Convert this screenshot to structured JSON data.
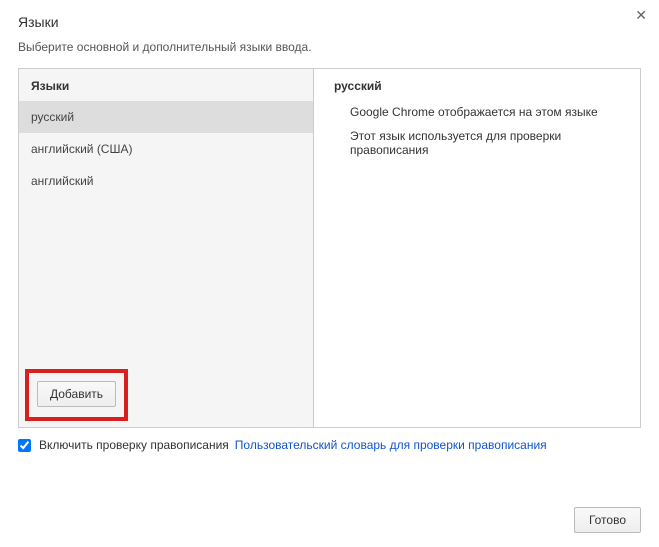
{
  "dialog": {
    "title": "Языки",
    "subtitle": "Выберите основной и дополнительный языки ввода."
  },
  "leftPane": {
    "header": "Языки",
    "languages": [
      {
        "name": "русский",
        "selected": true
      },
      {
        "name": "английский (США)",
        "selected": false
      },
      {
        "name": "английский",
        "selected": false
      }
    ],
    "addButton": "Добавить"
  },
  "rightPane": {
    "header": "русский",
    "line1": "Google Chrome отображается на этом языке",
    "line2": "Этот язык используется для проверки правописания"
  },
  "footer": {
    "spellcheckEnabled": true,
    "spellcheckLabel": "Включить проверку правописания",
    "dictLink": "Пользовательский словарь для проверки правописания",
    "doneButton": "Готово"
  }
}
